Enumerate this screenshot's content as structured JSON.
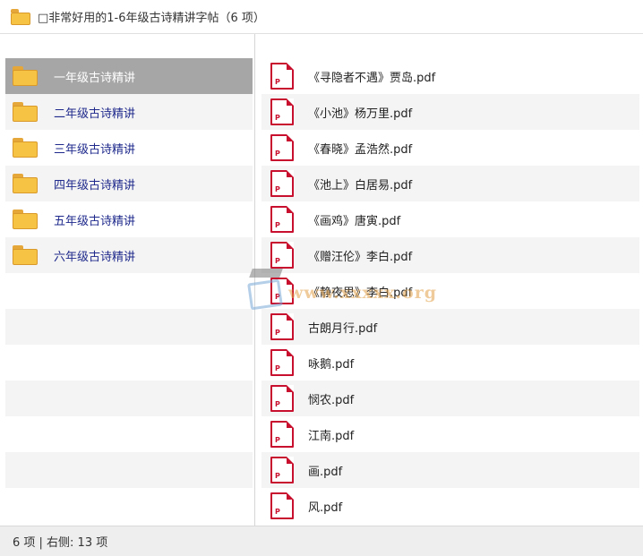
{
  "window": {
    "title": "□非常好用的1-6年级古诗精讲字帖（6 项）"
  },
  "left_pane": {
    "items": [
      {
        "label": "一年级古诗精讲",
        "icon": "folder-icon",
        "selected": true
      },
      {
        "label": "二年级古诗精讲",
        "icon": "folder-icon"
      },
      {
        "label": "三年级古诗精讲",
        "icon": "folder-icon"
      },
      {
        "label": "四年级古诗精讲",
        "icon": "folder-icon"
      },
      {
        "label": "五年级古诗精讲",
        "icon": "folder-icon"
      },
      {
        "label": "六年级古诗精讲",
        "icon": "folder-icon"
      }
    ]
  },
  "right_pane": {
    "items": [
      {
        "label": "《寻隐者不遇》贾岛.pdf",
        "icon": "pdf-icon"
      },
      {
        "label": "《小池》杨万里.pdf",
        "icon": "pdf-icon"
      },
      {
        "label": "《春晓》孟浩然.pdf",
        "icon": "pdf-icon"
      },
      {
        "label": "《池上》白居易.pdf",
        "icon": "pdf-icon"
      },
      {
        "label": "《画鸡》唐寅.pdf",
        "icon": "pdf-icon"
      },
      {
        "label": "《赠汪伦》李白.pdf",
        "icon": "pdf-icon"
      },
      {
        "label": "《静夜思》李白.pdf",
        "icon": "pdf-icon"
      },
      {
        "label": "古朗月行.pdf",
        "icon": "pdf-icon"
      },
      {
        "label": "咏鹅.pdf",
        "icon": "pdf-icon"
      },
      {
        "label": "悯农.pdf",
        "icon": "pdf-icon"
      },
      {
        "label": "江南.pdf",
        "icon": "pdf-icon"
      },
      {
        "label": "画.pdf",
        "icon": "pdf-icon"
      },
      {
        "label": "风.pdf",
        "icon": "pdf-icon"
      }
    ]
  },
  "watermark": {
    "text": "www.xxxxx.org"
  },
  "status": {
    "text": "6 项 | 右侧: 13 项"
  },
  "colors": {
    "selected_row": "#a6a6a6",
    "folder": "#f6c344",
    "pdf_red": "#c8102e",
    "link_blue": "#1f2a8c"
  }
}
